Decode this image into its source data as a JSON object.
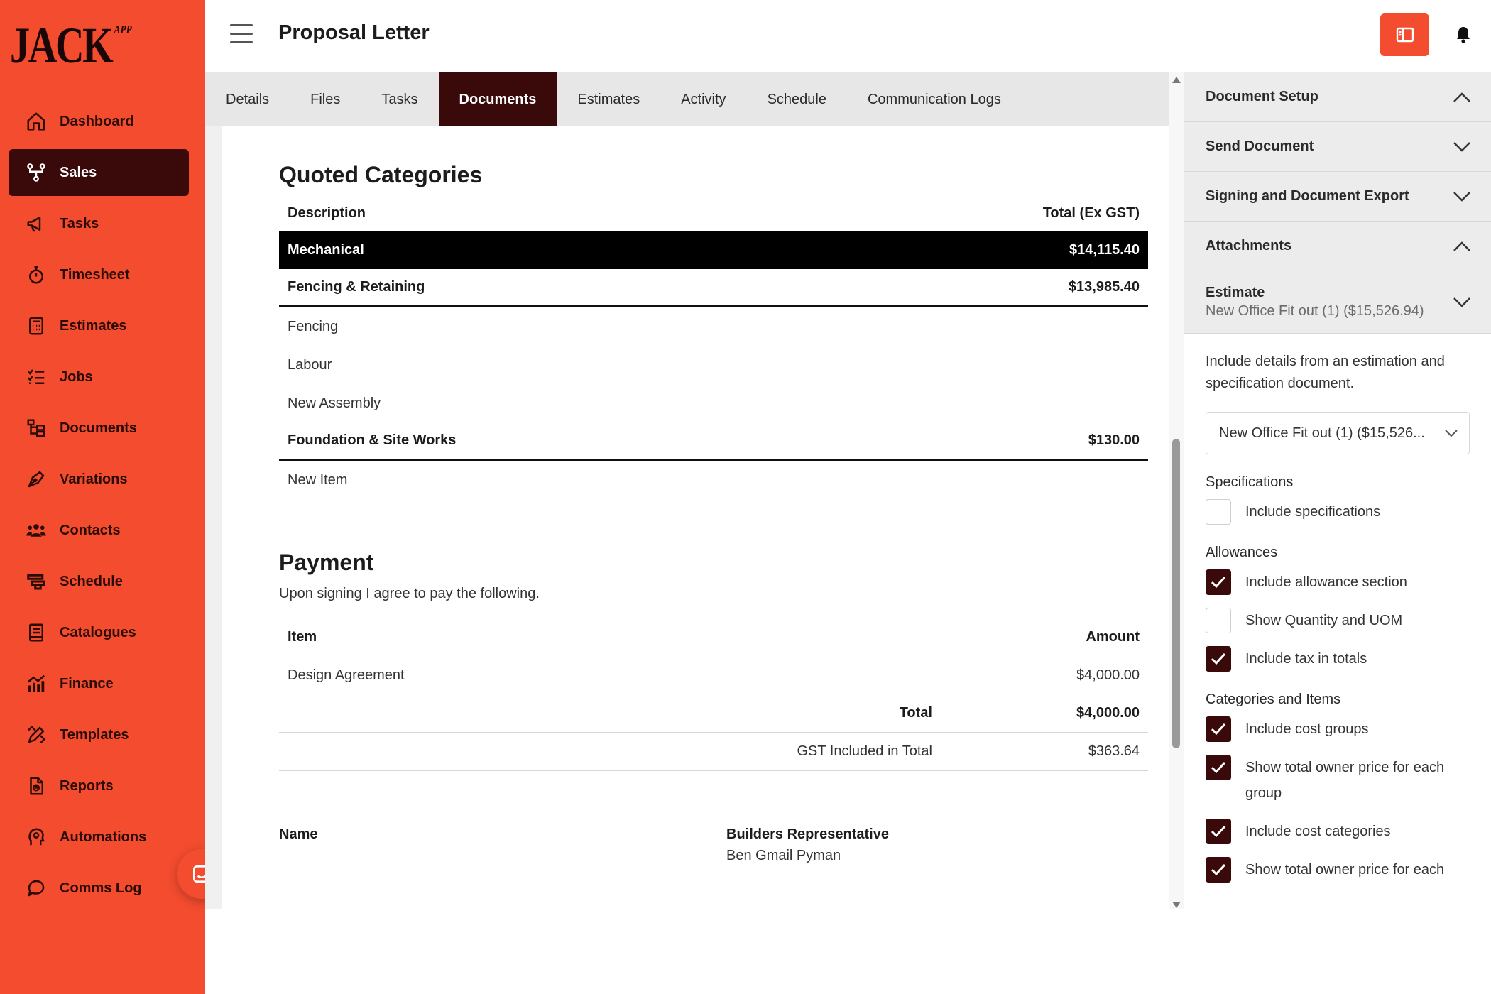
{
  "app": {
    "logo_text": "JACK",
    "logo_sup": "APP",
    "brand_color": "#f34c2f",
    "dark_color": "#3a0a0a"
  },
  "sidebar": {
    "items": [
      {
        "label": "Dashboard",
        "icon": "home-icon"
      },
      {
        "label": "Sales",
        "icon": "sitemap-icon",
        "active": true
      },
      {
        "label": "Tasks",
        "icon": "megaphone-icon"
      },
      {
        "label": "Timesheet",
        "icon": "stopwatch-icon"
      },
      {
        "label": "Estimates",
        "icon": "calculator-icon"
      },
      {
        "label": "Jobs",
        "icon": "checklist-icon"
      },
      {
        "label": "Documents",
        "icon": "folder-tree-icon"
      },
      {
        "label": "Variations",
        "icon": "pen-nib-icon"
      },
      {
        "label": "Contacts",
        "icon": "people-icon"
      },
      {
        "label": "Schedule",
        "icon": "schedule-icon"
      },
      {
        "label": "Catalogues",
        "icon": "book-icon"
      },
      {
        "label": "Finance",
        "icon": "chart-icon"
      },
      {
        "label": "Templates",
        "icon": "ruler-pencil-icon"
      },
      {
        "label": "Reports",
        "icon": "report-icon"
      },
      {
        "label": "Automations",
        "icon": "gear-head-icon"
      },
      {
        "label": "Comms Log",
        "icon": "comment-icon"
      }
    ]
  },
  "header": {
    "title": "Proposal Letter"
  },
  "tabs": [
    {
      "label": "Details"
    },
    {
      "label": "Files"
    },
    {
      "label": "Tasks"
    },
    {
      "label": "Documents",
      "active": true
    },
    {
      "label": "Estimates"
    },
    {
      "label": "Activity"
    },
    {
      "label": "Schedule"
    },
    {
      "label": "Communication Logs"
    }
  ],
  "document": {
    "quoted": {
      "heading": "Quoted Categories",
      "col_description": "Description",
      "col_total": "Total (Ex GST)",
      "categories": [
        {
          "name": "Mechanical",
          "total": "$14,115.40",
          "highlight": true,
          "items": []
        },
        {
          "name": "Fencing & Retaining",
          "total": "$13,985.40",
          "items": [
            "Fencing",
            "Labour",
            "New Assembly"
          ]
        },
        {
          "name": "Foundation & Site Works",
          "total": "$130.00",
          "items": [
            "New Item"
          ]
        }
      ]
    },
    "payment": {
      "heading": "Payment",
      "intro": "Upon signing I agree to pay the following.",
      "col_item": "Item",
      "col_amount": "Amount",
      "rows": [
        {
          "item": "Design Agreement",
          "amount": "$4,000.00"
        }
      ],
      "total_label": "Total",
      "total_value": "$4,000.00",
      "gst_label": "GST Included in Total",
      "gst_value": "$363.64"
    },
    "signature": {
      "name_label": "Name",
      "rep_label": "Builders Representative",
      "rep_name": "Ben Gmail Pyman"
    }
  },
  "panel": {
    "sections": [
      {
        "label": "Document Setup",
        "expanded": true
      },
      {
        "label": "Send Document",
        "expanded": false
      },
      {
        "label": "Signing and Document Export",
        "expanded": false
      },
      {
        "label": "Attachments",
        "expanded": true
      }
    ],
    "estimate": {
      "label": "Estimate",
      "sub": "New Office Fit out (1) ($15,526.94)",
      "description": "Include details from an estimation and specification document.",
      "select_value": "New Office Fit out (1) ($15,526..."
    },
    "groups": [
      {
        "title": "Specifications",
        "options": [
          {
            "label": "Include specifications",
            "checked": false
          }
        ]
      },
      {
        "title": "Allowances",
        "options": [
          {
            "label": "Include allowance section",
            "checked": true
          },
          {
            "label": "Show Quantity and UOM",
            "checked": false
          },
          {
            "label": "Include tax in totals",
            "checked": true
          }
        ]
      },
      {
        "title": "Categories and Items",
        "options": [
          {
            "label": "Include cost groups",
            "checked": true
          },
          {
            "label": "Show total owner price for each group",
            "checked": true
          },
          {
            "label": "Include cost categories",
            "checked": true
          },
          {
            "label": "Show total owner price for each",
            "checked": true
          }
        ]
      }
    ]
  }
}
